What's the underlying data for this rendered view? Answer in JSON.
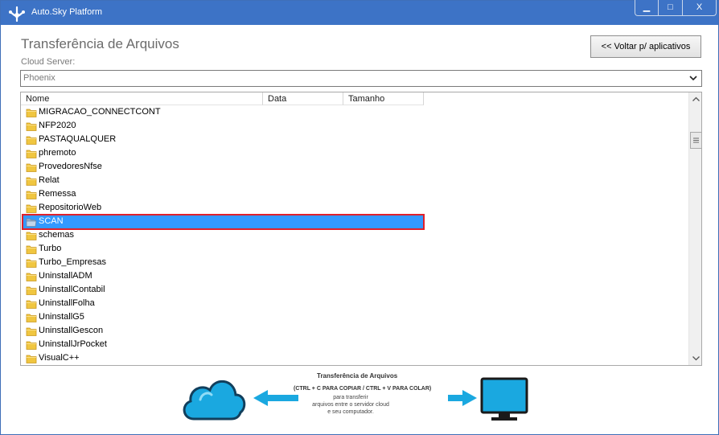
{
  "window": {
    "title": "Auto.Sky Platform",
    "controls": {
      "minimize": "▁",
      "maximize": "□",
      "close": "X"
    }
  },
  "page": {
    "title": "Transferência de Arquivos",
    "back_button": "<< Voltar p/ aplicativos"
  },
  "server": {
    "label": "Cloud Server:",
    "selected": "Phoenix"
  },
  "table": {
    "columns": [
      "Nome",
      "Data",
      "Tamanho"
    ],
    "rows": [
      {
        "name": "MIGRACAO_CONNECTCONT",
        "date": "",
        "size": ""
      },
      {
        "name": "NFP2020",
        "date": "",
        "size": ""
      },
      {
        "name": "PASTAQUALQUER",
        "date": "",
        "size": ""
      },
      {
        "name": "phremoto",
        "date": "",
        "size": ""
      },
      {
        "name": "ProvedoresNfse",
        "date": "",
        "size": ""
      },
      {
        "name": "Relat",
        "date": "",
        "size": ""
      },
      {
        "name": "Remessa",
        "date": "",
        "size": ""
      },
      {
        "name": "RepositorioWeb",
        "date": "",
        "size": ""
      },
      {
        "name": "SCAN",
        "date": "",
        "size": "",
        "selected": true
      },
      {
        "name": "schemas",
        "date": "",
        "size": ""
      },
      {
        "name": "Turbo",
        "date": "",
        "size": ""
      },
      {
        "name": "Turbo_Empresas",
        "date": "",
        "size": ""
      },
      {
        "name": "UninstallADM",
        "date": "",
        "size": ""
      },
      {
        "name": "UninstallContabil",
        "date": "",
        "size": ""
      },
      {
        "name": "UninstallFolha",
        "date": "",
        "size": ""
      },
      {
        "name": "UninstallG5",
        "date": "",
        "size": ""
      },
      {
        "name": "UninstallGescon",
        "date": "",
        "size": ""
      },
      {
        "name": "UninstallJrPocket",
        "date": "",
        "size": ""
      },
      {
        "name": "VisualC++",
        "date": "",
        "size": ""
      }
    ],
    "row_icon": "folder-icon",
    "selected_row_icon": "folder-open-icon"
  },
  "illustration": {
    "title": "Transferência de Arquivos",
    "shortcut": "(CTRL + C PARA COPIAR / CTRL + V PARA COLAR)",
    "line1": "para transferir",
    "line2": "arquivos entre o servidor cloud",
    "line3": "e seu computador.",
    "left_icon": "cloud-icon",
    "right_icon": "monitor-icon"
  },
  "colors": {
    "titlebar": "#3d73c6",
    "selection": "#3399ff",
    "highlight_box": "#e0202a",
    "illustration_blue": "#1aa8e0"
  }
}
